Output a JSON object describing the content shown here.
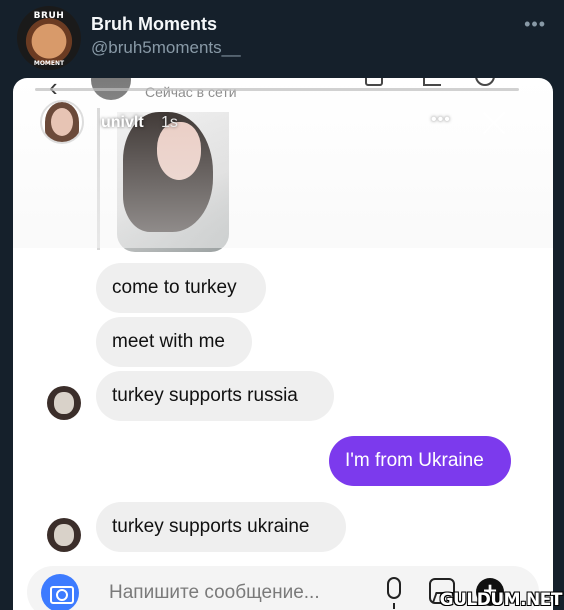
{
  "tweet": {
    "display_name": "Bruh Moments",
    "handle": "@bruh5moments__",
    "avatar_text_top": "BRUH",
    "avatar_text_bottom": "MOMENT",
    "more_icon": "more-dots-icon"
  },
  "dm": {
    "status": "Сейчас в сети"
  },
  "story": {
    "username": "univlt",
    "time": "1s",
    "more": "•••"
  },
  "messages": [
    {
      "text": "come to turkey",
      "outgoing": false
    },
    {
      "text": "meet with me",
      "outgoing": false
    },
    {
      "text": "turkey supports russia",
      "outgoing": false
    },
    {
      "text": "I'm from Ukraine",
      "outgoing": true
    },
    {
      "text": "turkey supports ukraine",
      "outgoing": false
    }
  ],
  "composer": {
    "placeholder": "Напишите сообщение..."
  },
  "colors": {
    "background": "#15202b",
    "outgoing_bubble": "#7c3aed",
    "incoming_bubble": "#efefef",
    "camera_button": "#3d7bff"
  },
  "watermark": "GULDUM.NET"
}
